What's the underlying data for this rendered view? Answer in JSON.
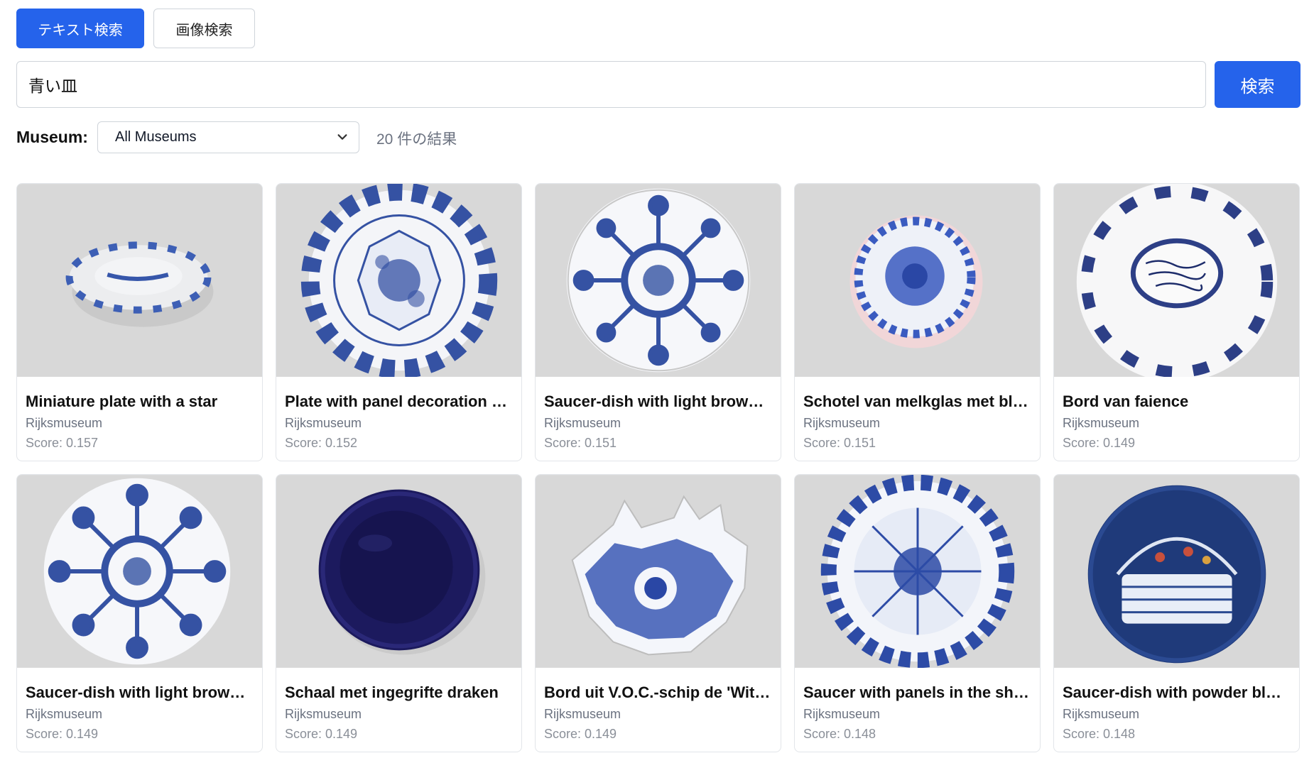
{
  "tabs": [
    {
      "label": "テキスト検索",
      "active": true
    },
    {
      "label": "画像検索",
      "active": false
    }
  ],
  "search": {
    "value": "青い皿",
    "button_label": "検索"
  },
  "filter": {
    "label": "Museum:",
    "selected": "All Museums"
  },
  "results": {
    "count_text": "20 件の結果",
    "items": [
      {
        "title": "Miniature plate with a star",
        "museum": "Rijksmuseum",
        "score": "Score: 0.157"
      },
      {
        "title": "Plate with panel decoration …",
        "museum": "Rijksmuseum",
        "score": "Score: 0.152"
      },
      {
        "title": "Saucer-dish with light brown…",
        "museum": "Rijksmuseum",
        "score": "Score: 0.151"
      },
      {
        "title": "Schotel van melkglas met bl…",
        "museum": "Rijksmuseum",
        "score": "Score: 0.151"
      },
      {
        "title": "Bord van faience",
        "museum": "Rijksmuseum",
        "score": "Score: 0.149"
      },
      {
        "title": "Saucer-dish with light brown…",
        "museum": "Rijksmuseum",
        "score": "Score: 0.149"
      },
      {
        "title": "Schaal met ingegrifte draken",
        "museum": "Rijksmuseum",
        "score": "Score: 0.149"
      },
      {
        "title": "Bord uit V.O.C.-schip de 'Wit…",
        "museum": "Rijksmuseum",
        "score": "Score: 0.149"
      },
      {
        "title": "Saucer with panels in the sh…",
        "museum": "Rijksmuseum",
        "score": "Score: 0.148"
      },
      {
        "title": "Saucer-dish with powder blu…",
        "museum": "Rijksmuseum",
        "score": "Score: 0.148"
      }
    ]
  },
  "colors": {
    "accent": "#2563eb",
    "plate_blue": "#2f4fa8",
    "thumb_bg": "#dcdcdc"
  }
}
